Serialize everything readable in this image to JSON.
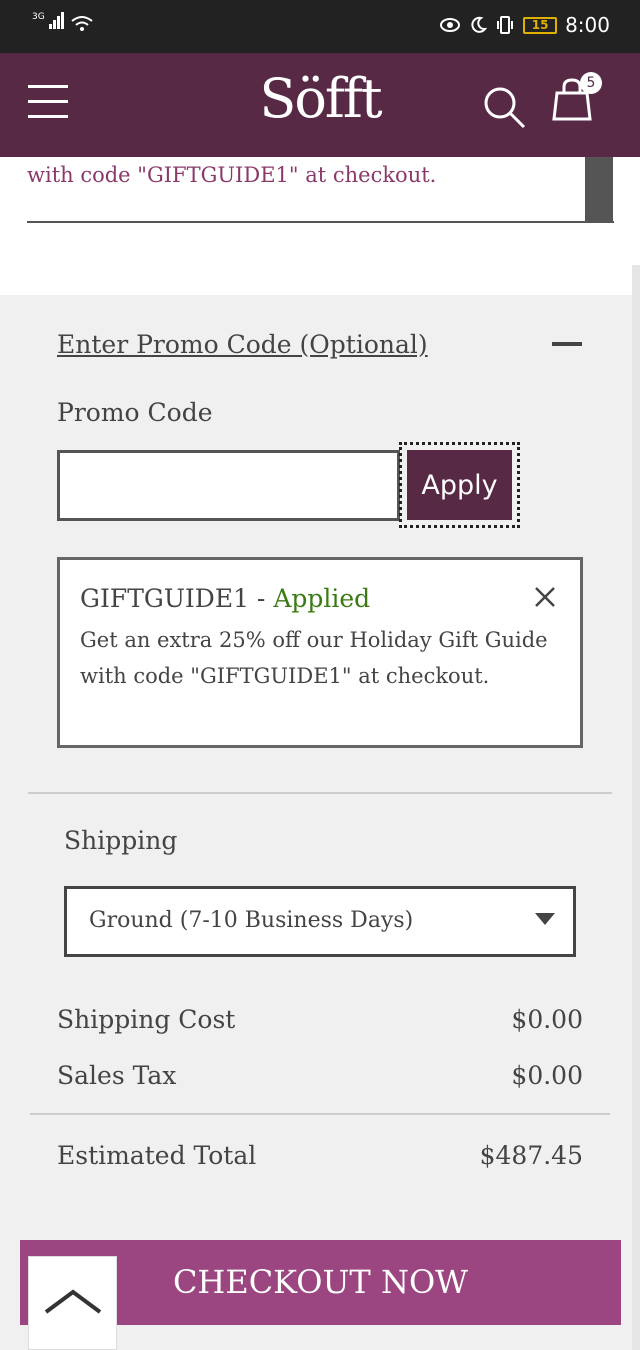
{
  "status_bar": {
    "network": "3G",
    "battery": "15",
    "time": "8:00"
  },
  "header": {
    "logo": "Söfft",
    "cart_count": "5"
  },
  "banner": {
    "text": "with code \"GIFTGUIDE1\" at checkout."
  },
  "promo": {
    "toggle_label": "Enter Promo Code (Optional)",
    "field_label": "Promo Code",
    "input_value": "",
    "apply_label": "Apply",
    "applied_code": "GIFTGUIDE1",
    "applied_separator": " - ",
    "applied_status": "Applied",
    "applied_description": "Get an extra 25% off our Holiday Gift Guide with code \"GIFTGUIDE1\" at checkout."
  },
  "shipping": {
    "label": "Shipping",
    "selected_option": "Ground (7-10 Business Days)"
  },
  "summary": {
    "shipping_cost_label": "Shipping Cost",
    "shipping_cost_value": "$0.00",
    "sales_tax_label": "Sales Tax",
    "sales_tax_value": "$0.00",
    "total_label": "Estimated Total",
    "total_value": "$487.45"
  },
  "checkout": {
    "label": "CHECKOUT NOW"
  },
  "colors": {
    "brand": "#572945",
    "checkout": "#9b4680",
    "applied_green": "#3a7a12"
  },
  "icons": {
    "menu": "hamburger-icon",
    "search": "search-icon",
    "cart": "shopping-bag-icon",
    "close": "close-icon",
    "dropdown": "caret-down-icon",
    "scroll_top": "chevron-up-icon"
  }
}
